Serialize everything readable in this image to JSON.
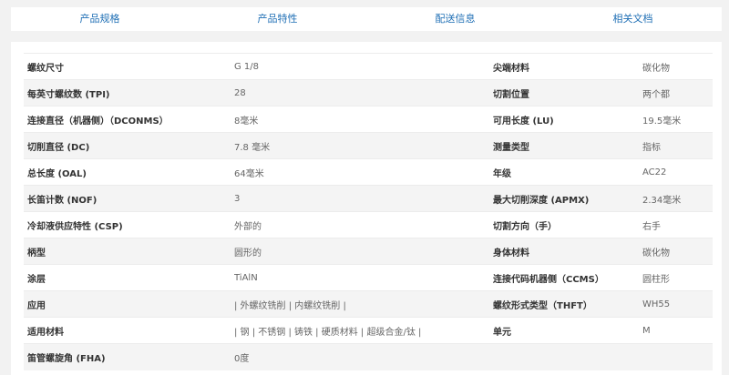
{
  "tabs": [
    "产品规格",
    "产品特性",
    "配送信息",
    "相关文档"
  ],
  "rows": [
    {
      "label1": "螺纹尺寸",
      "value1": "G 1/8",
      "label2": "尖端材料",
      "value2": "碳化物"
    },
    {
      "label1": "每英寸螺纹数 (TPI)",
      "value1": "28",
      "label2": "切割位置",
      "value2": "两个都"
    },
    {
      "label1": "连接直径（机器侧）（DCONMS）",
      "value1": "8毫米",
      "label2": "可用长度 (LU)",
      "value2": "19.5毫米"
    },
    {
      "label1": "切削直径 (DC)",
      "value1": "7.8 毫米",
      "label2": "测量类型",
      "value2": "指标"
    },
    {
      "label1": "总长度 (OAL)",
      "value1": "64毫米",
      "label2": "年级",
      "value2": "AC22"
    },
    {
      "label1": "长笛计数 (NOF)",
      "value1": "3",
      "label2": "最大切削深度 (APMX)",
      "value2": "2.34毫米"
    },
    {
      "label1": "冷却液供应特性 (CSP)",
      "value1": "外部的",
      "label2": "切割方向（手）",
      "value2": "右手"
    },
    {
      "label1": "柄型",
      "value1": "圆形的",
      "label2": "身体材料",
      "value2": "碳化物"
    },
    {
      "label1": "涂层",
      "value1": "TiAlN",
      "label2": "连接代码机器侧（CCMS）",
      "value2": "圆柱形"
    },
    {
      "label1": "应用",
      "value1": "| 外螺纹铣削 | 内螺纹铣削 |",
      "label2": "螺纹形式类型（THFT）",
      "value2": "WH55"
    },
    {
      "label1": "适用材料",
      "value1": "| 钢 | 不锈钢 | 铸铁 | 硬质材料 | 超级合金/钛 |",
      "label2": "单元",
      "value2": "M"
    },
    {
      "label1": "笛管螺旋角 (FHA)",
      "value1": "0度",
      "label2": "",
      "value2": ""
    }
  ]
}
